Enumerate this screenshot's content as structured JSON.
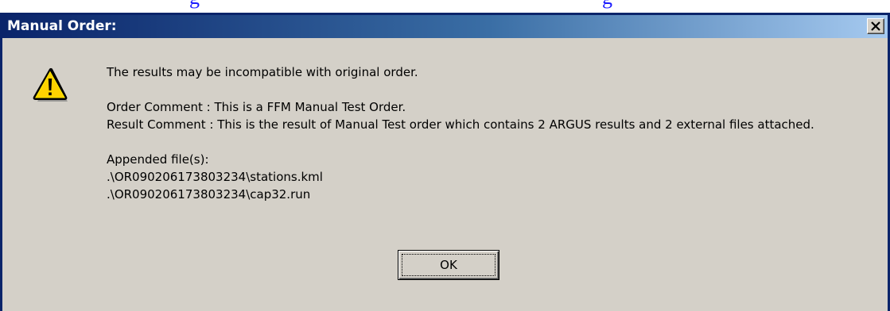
{
  "background_link": {
    "fragment_left": "g",
    "fragment_right": "g"
  },
  "dialog": {
    "title": "Manual Order:",
    "close_icon": "close-icon",
    "warning_icon": "warning-icon",
    "message": {
      "line1": "The results may be incompatible with original order.",
      "order_comment": "Order Comment : This is a FFM Manual Test Order.",
      "result_comment": "Result Comment : This is the result of Manual Test order which contains 2 ARGUS results and 2 external files attached.",
      "appended_label": "Appended file(s):",
      "files": [
        ".\\OR090206173803234\\stations.kml",
        ".\\OR090206173803234\\cap32.run"
      ]
    },
    "ok_label": "OK"
  },
  "colors": {
    "titlebar_start": "#0a246a",
    "titlebar_end": "#a6caf0",
    "face": "#d4d0c8",
    "link": "#1a1aff"
  }
}
